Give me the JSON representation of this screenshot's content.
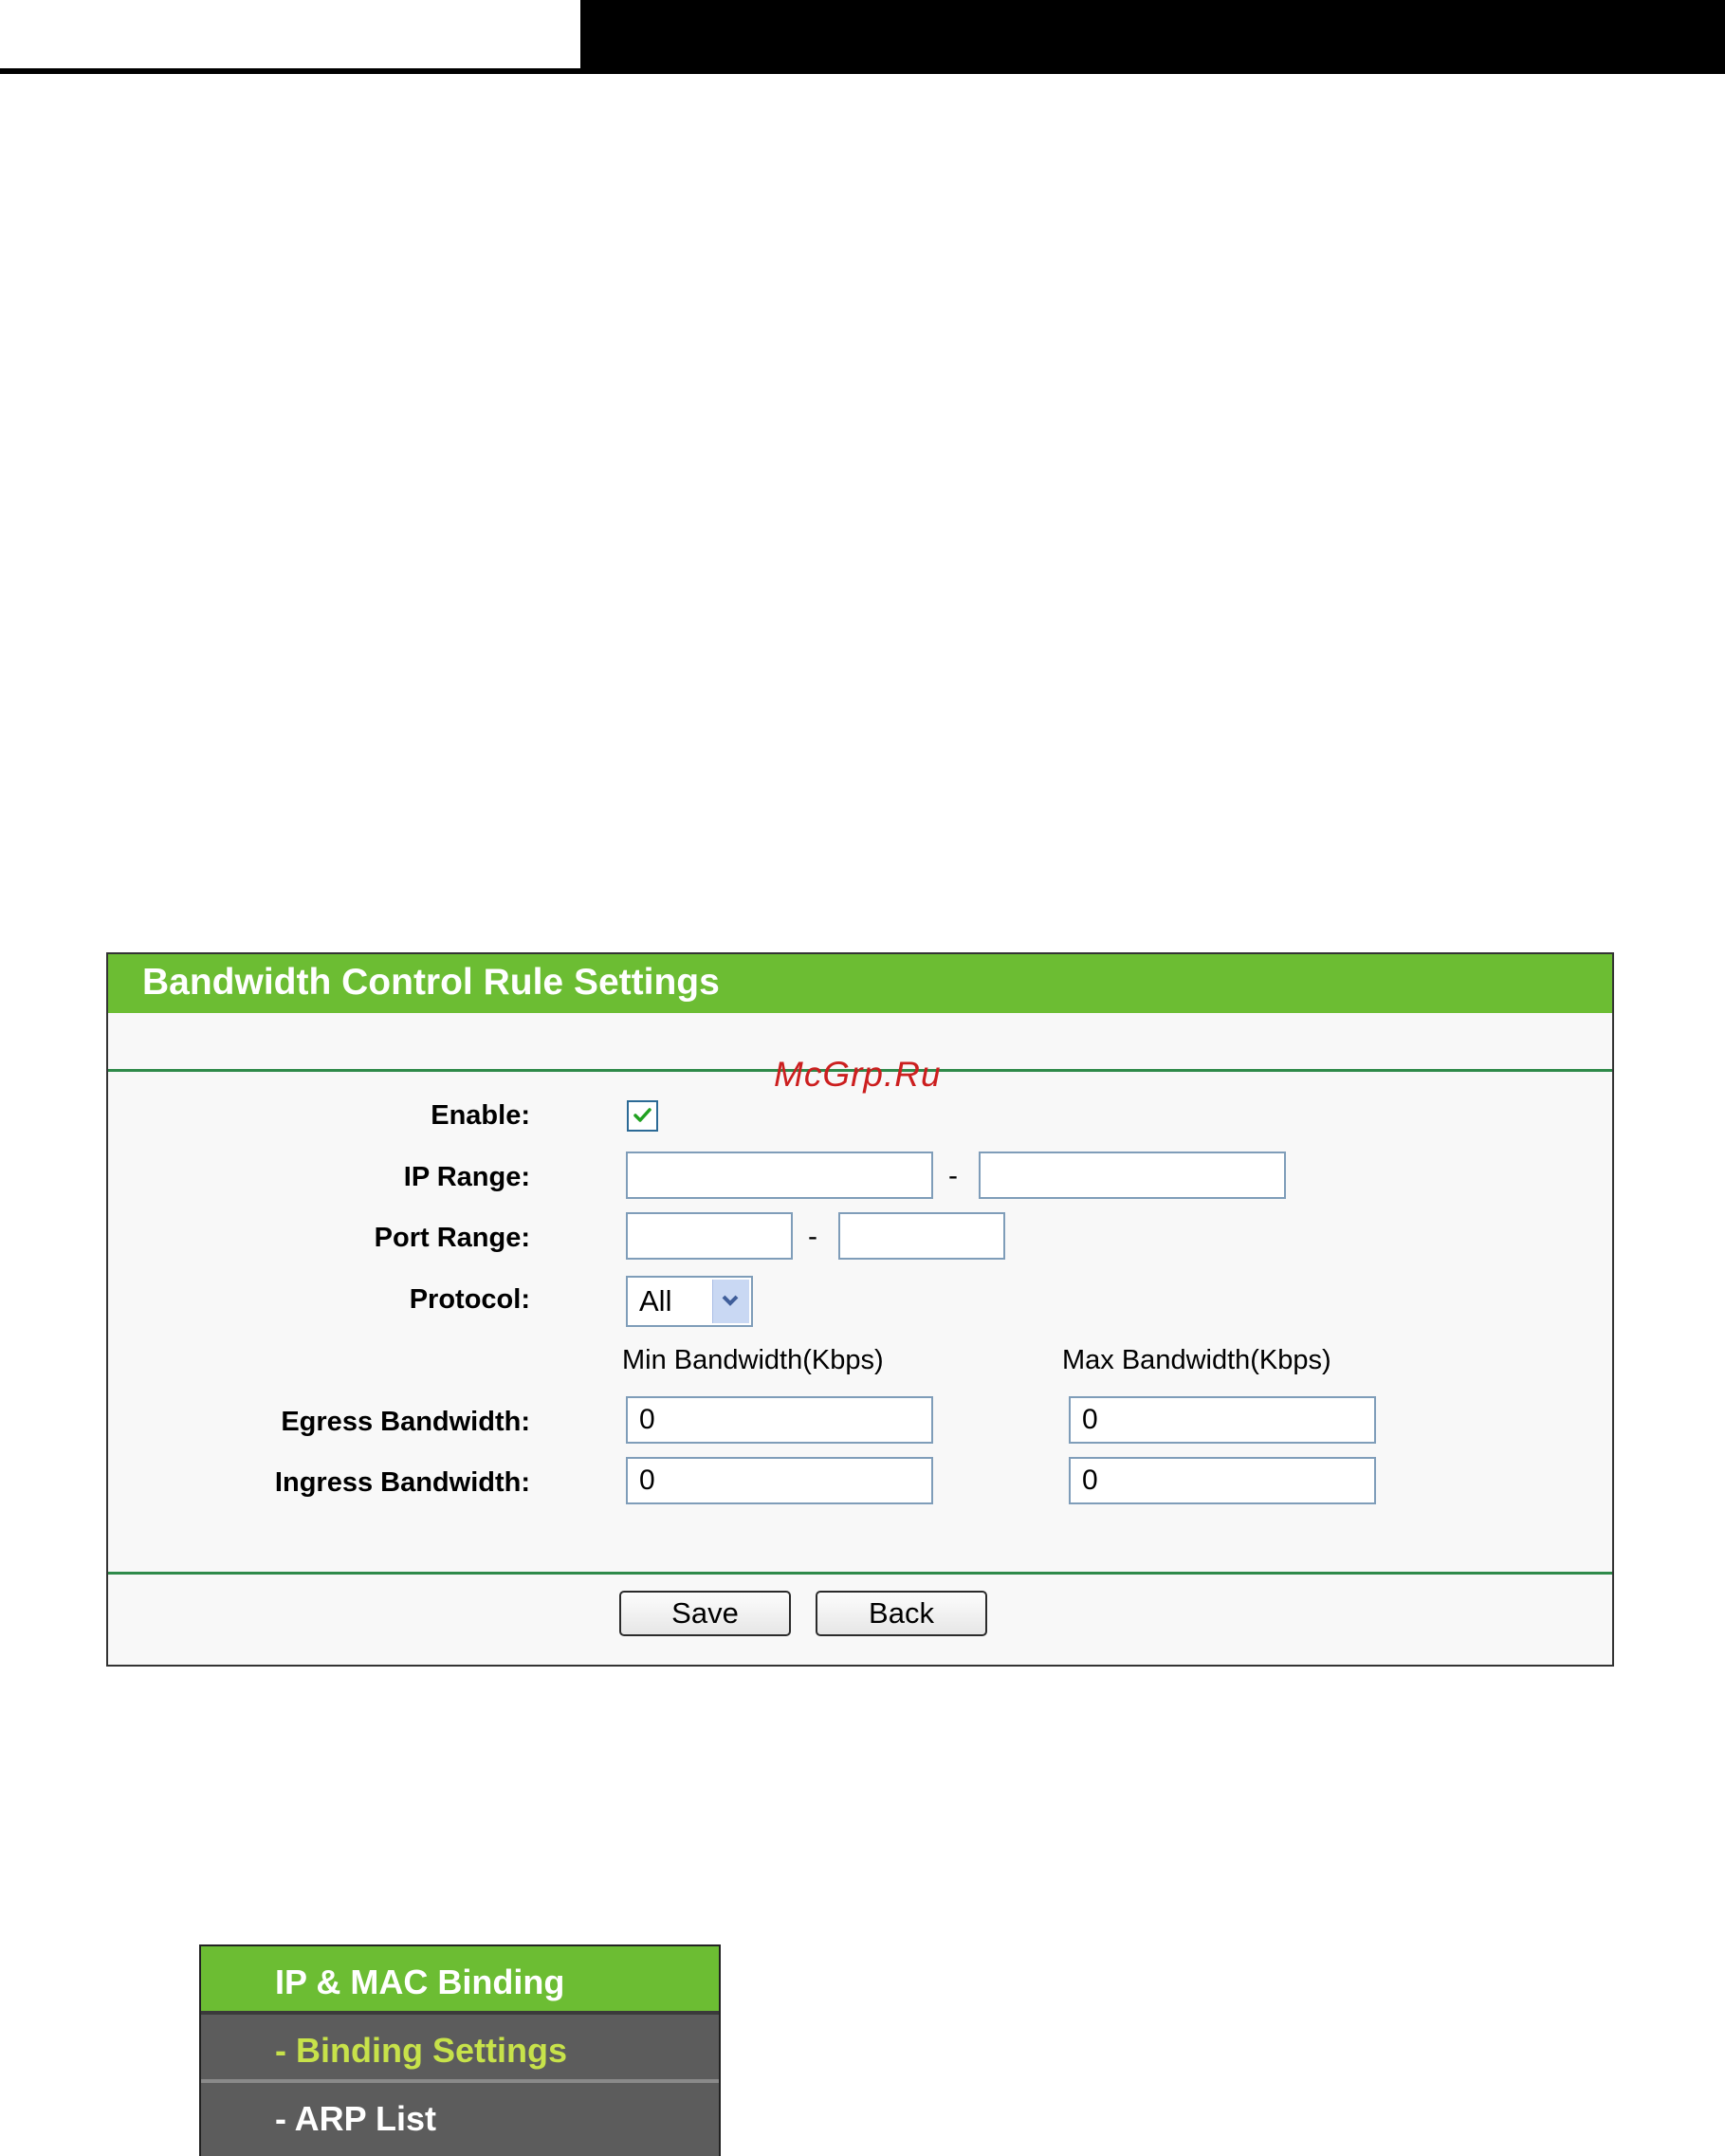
{
  "panel": {
    "title": "Bandwidth Control Rule Settings",
    "watermark": "McGrp.Ru",
    "enable": {
      "label": "Enable:",
      "checked": true
    },
    "ip_range": {
      "label": "IP Range:",
      "start": "",
      "end": "",
      "separator": "-"
    },
    "port_range": {
      "label": "Port Range:",
      "start": "",
      "end": "",
      "separator": "-"
    },
    "protocol": {
      "label": "Protocol:",
      "value": "All"
    },
    "columns": {
      "min": "Min Bandwidth(Kbps)",
      "max": "Max Bandwidth(Kbps)"
    },
    "egress": {
      "label": "Egress Bandwidth:",
      "min": "0",
      "max": "0"
    },
    "ingress": {
      "label": "Ingress Bandwidth:",
      "min": "0",
      "max": "0"
    },
    "buttons": {
      "save": "Save",
      "back": "Back"
    }
  },
  "menu": {
    "main": "IP & MAC Binding",
    "items": [
      "- Binding Settings",
      "- ARP List"
    ]
  },
  "colors": {
    "header_green": "#6cbd33",
    "active_submenu_text": "#c7e24a",
    "watermark_red": "#cc1f1f"
  }
}
